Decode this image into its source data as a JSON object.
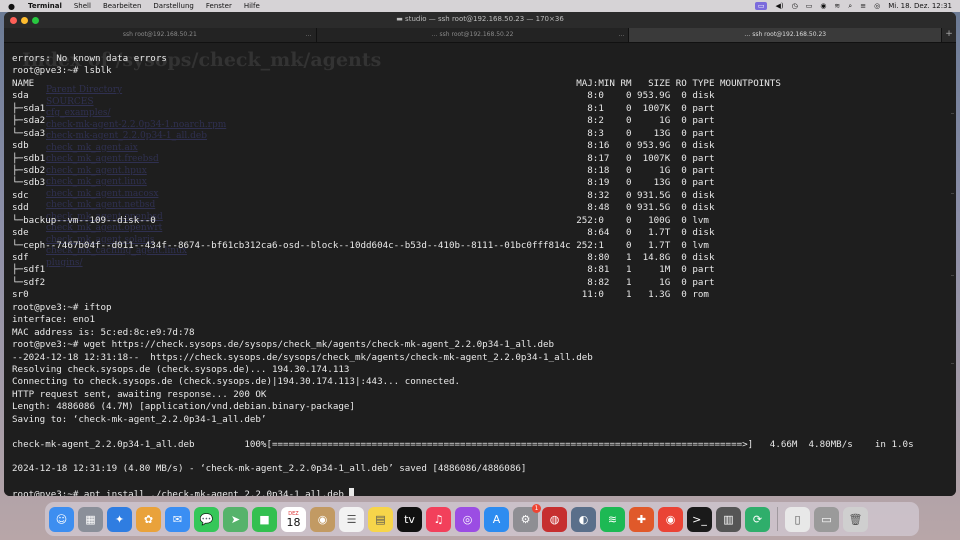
{
  "menubar": {
    "apple_icon": "apple-icon",
    "app_name": "Terminal",
    "menus": [
      "Shell",
      "Bearbeiten",
      "Darstellung",
      "Fenster",
      "Hilfe"
    ],
    "clock": "Mi. 18. Dez.  12:31"
  },
  "window": {
    "title": "studio — ssh root@192.168.50.23 — 170×36",
    "tabs": [
      {
        "label": "ssh root@192.168.50.21",
        "active": false
      },
      {
        "label": "… ssh root@192.168.50.22",
        "active": false
      },
      {
        "label": "… ssh root@192.168.50.23",
        "active": true
      }
    ],
    "new_tab": "+"
  },
  "ghost_page": {
    "title": "Index of /sysops/check_mk/agents",
    "links": [
      "Parent Directory",
      "SOURCES",
      "cfg_examples/",
      "check-mk-agent-2.2.0p34-1.noarch.rpm",
      "check-mk-agent_2.2.0p34-1_all.deb",
      "check_mk_agent.aix",
      "check_mk_agent.freebsd",
      "check_mk_agent.hpux",
      "check_mk_agent.linux",
      "check_mk_agent.macosx",
      "check_mk_agent.netbsd",
      "check_mk_agent.openbsd",
      "check_mk_agent.openwrt",
      "check_mk_agent.solaris",
      "check_mk_caching_agent.linux",
      "plugins/"
    ]
  },
  "terminal": {
    "lines": [
      "errors: No known data errors",
      "root@pve3:~# lsblk",
      "NAME                                                                                                  MAJ:MIN RM   SIZE RO TYPE MOUNTPOINTS",
      "sda                                                                                                     8:0    0 953.9G  0 disk",
      "├─sda1                                                                                                  8:1    0  1007K  0 part",
      "├─sda2                                                                                                  8:2    0     1G  0 part",
      "└─sda3                                                                                                  8:3    0    13G  0 part",
      "sdb                                                                                                     8:16   0 953.9G  0 disk",
      "├─sdb1                                                                                                  8:17   0  1007K  0 part",
      "├─sdb2                                                                                                  8:18   0     1G  0 part",
      "└─sdb3                                                                                                  8:19   0    13G  0 part",
      "sdc                                                                                                     8:32   0 931.5G  0 disk",
      "sdd                                                                                                     8:48   0 931.5G  0 disk",
      "└─backup--vm--109--disk--0                                                                            252:0    0   100G  0 lvm",
      "sde                                                                                                     8:64   0   1.7T  0 disk",
      "└─ceph--7467b04f--d011--434f--8674--bf61cb312ca6-osd--block--10dd604c--b53d--410b--8111--01bc0fff814c 252:1    0   1.7T  0 lvm",
      "sdf                                                                                                     8:80   1  14.8G  0 disk",
      "├─sdf1                                                                                                  8:81   1     1M  0 part",
      "└─sdf2                                                                                                  8:82   1     1G  0 part",
      "sr0                                                                                                    11:0    1   1.3G  0 rom",
      "root@pve3:~# iftop",
      "interface: eno1",
      "MAC address is: 5c:ed:8c:e9:7d:78",
      "root@pve3:~# wget https://check.sysops.de/sysops/check_mk/agents/check-mk-agent_2.2.0p34-1_all.deb",
      "--2024-12-18 12:31:18--  https://check.sysops.de/sysops/check_mk/agents/check-mk-agent_2.2.0p34-1_all.deb",
      "Resolving check.sysops.de (check.sysops.de)... 194.30.174.113",
      "Connecting to check.sysops.de (check.sysops.de)|194.30.174.113|:443... connected.",
      "HTTP request sent, awaiting response... 200 OK",
      "Length: 4886086 (4.7M) [application/vnd.debian.binary-package]",
      "Saving to: ‘check-mk-agent_2.2.0p34-1_all.deb’",
      "",
      "check-mk-agent_2.2.0p34-1_all.deb         100%[=====================================================================================>]   4.66M  4.80MB/s    in 1.0s",
      "",
      "2024-12-18 12:31:19 (4.80 MB/s) - ‘check-mk-agent_2.2.0p34-1_all.deb’ saved [4886086/4886086]",
      "",
      "root@pve3:~# apt install ./check-mk-agent_2.2.0p34-1_all.deb "
    ]
  },
  "dock": {
    "apps": [
      {
        "name": "finder-icon",
        "glyph": "☺",
        "color": "#3d8ef0"
      },
      {
        "name": "launchpad-icon",
        "glyph": "▦",
        "color": "#8a8f99"
      },
      {
        "name": "safari-icon",
        "glyph": "✦",
        "color": "#2f7de1"
      },
      {
        "name": "photos-icon",
        "glyph": "✿",
        "color": "#e9a23b"
      },
      {
        "name": "mail-icon",
        "glyph": "✉",
        "color": "#3a8ef3"
      },
      {
        "name": "messages-icon",
        "glyph": "💬",
        "color": "#35c759"
      },
      {
        "name": "maps-icon",
        "glyph": "➤",
        "color": "#56b36b"
      },
      {
        "name": "facetime-icon",
        "glyph": "■",
        "color": "#33c04f"
      },
      {
        "name": "calendar-icon",
        "glyph": "",
        "color": "#ffffff",
        "month": "DEZ",
        "day": "18"
      },
      {
        "name": "contacts-icon",
        "glyph": "◉",
        "color": "#c29a63"
      },
      {
        "name": "reminders-icon",
        "glyph": "☰",
        "color": "#f2f2f2"
      },
      {
        "name": "notes-icon",
        "glyph": "▤",
        "color": "#f7d54a"
      },
      {
        "name": "appletv-icon",
        "glyph": "tv",
        "color": "#111111"
      },
      {
        "name": "music-icon",
        "glyph": "♫",
        "color": "#f2405b"
      },
      {
        "name": "podcasts-icon",
        "glyph": "◎",
        "color": "#9b4de3"
      },
      {
        "name": "appstore-icon",
        "glyph": "A",
        "color": "#2d8cf0"
      },
      {
        "name": "system-settings-icon",
        "glyph": "⚙",
        "color": "#8e8e93",
        "badge": "1"
      },
      {
        "name": "vpn-icon",
        "glyph": "◍",
        "color": "#c62f2f"
      },
      {
        "name": "proxyman-icon",
        "glyph": "◐",
        "color": "#5a6f8a"
      },
      {
        "name": "spotify-icon",
        "glyph": "≋",
        "color": "#1db954"
      },
      {
        "name": "brave-icon",
        "glyph": "✚",
        "color": "#e0592a"
      },
      {
        "name": "chrome-icon",
        "glyph": "◉",
        "color": "#ea4335"
      },
      {
        "name": "terminal-icon",
        "glyph": ">_",
        "color": "#1a1a1a"
      },
      {
        "name": "calculator-icon",
        "glyph": "▥",
        "color": "#555555"
      },
      {
        "name": "sync-icon",
        "glyph": "⟳",
        "color": "#2fae6b"
      },
      {
        "name": "document-icon",
        "glyph": "▯",
        "color": "#e8e8e8"
      },
      {
        "name": "downloads-stack-icon",
        "glyph": "▭",
        "color": "#9a9a9a"
      },
      {
        "name": "trash-icon",
        "glyph": "🗑",
        "color": "#cfcfcf"
      }
    ]
  }
}
